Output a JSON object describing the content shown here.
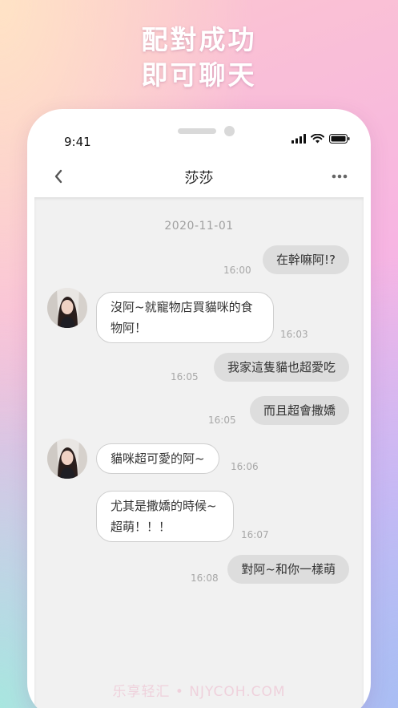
{
  "promo": {
    "line1": "配對成功",
    "line2": "即可聊天"
  },
  "status_bar": {
    "time": "9:41"
  },
  "header": {
    "title": "莎莎"
  },
  "chat": {
    "date": "2020-11-01",
    "messages": [
      {
        "side": "sent",
        "text": "在幹嘛阿!?",
        "time": "16:00"
      },
      {
        "side": "received",
        "text_line1": "沒阿~就寵物店買貓咪的食",
        "text_line2": "物阿！",
        "time": "16:03"
      },
      {
        "side": "sent",
        "text": "我家這隻貓也超愛吃",
        "time": "16:05"
      },
      {
        "side": "sent",
        "text": "而且超會撒嬌",
        "time": "16:05"
      },
      {
        "side": "received",
        "text": "貓咪超可愛的阿~",
        "time": "16:06"
      },
      {
        "side": "received",
        "text_line1": "尤其是撒嬌的時候~",
        "text_line2": "超萌！！！",
        "time": "16:07"
      },
      {
        "side": "sent",
        "text": "對阿~和你一樣萌",
        "time": "16:08"
      }
    ]
  },
  "watermark": "乐享轻汇 • NJYCOH.COM",
  "icons": [
    "back-chevron-icon",
    "more-dots-icon",
    "signal-icon",
    "wifi-icon",
    "battery-icon"
  ],
  "colors": {
    "sent_bubble": "#dddddd",
    "received_bubble": "#ffffff",
    "chat_bg": "#f1f1f1"
  }
}
